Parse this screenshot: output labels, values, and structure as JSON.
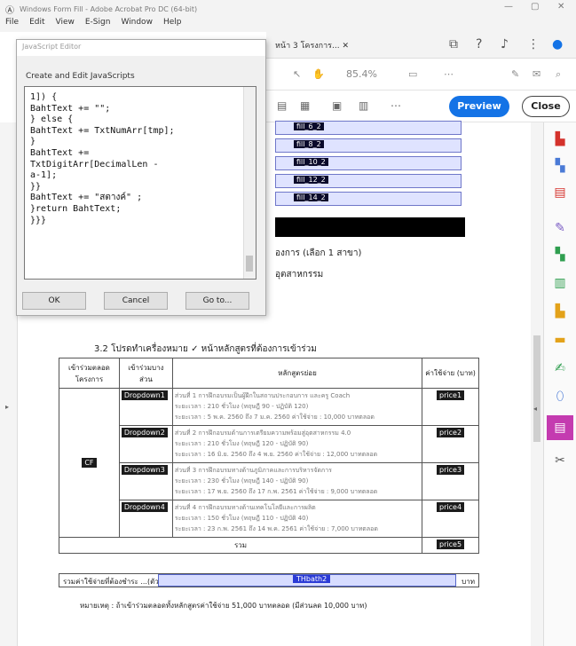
{
  "window": {
    "title": "Windows Form Fill - Adobe Acrobat Pro DC (64-bit)",
    "controls": [
      "—",
      "▢",
      "✕"
    ]
  },
  "menu": [
    "File",
    "Edit",
    "View",
    "E-Sign",
    "Window",
    "Help"
  ],
  "tab": {
    "label": "หน้า 3 โครงการ..."
  },
  "toolbar": {
    "zoom": "85.4%"
  },
  "edit_bar": {
    "preview": "Preview",
    "close": "Close"
  },
  "fields": [
    "fill_6_2",
    "fill_8_2",
    "fill_10_2",
    "fill_12_2",
    "fill_14_2"
  ],
  "doc_text": {
    "line1": "องการ (เลือก 1 สาขา)",
    "line2": "อุตสาหกรรม",
    "heading": "3.2 โปรดทำเครื่องหมาย ✓ หน้าหลักสูตรที่ต้องการเข้าร่วม",
    "footnote": "หมายเหตุ : ถ้าเข้าร่วมตลอดทั้งหลักสูตรค่าใช้จ่าย 51,000 บาทตลอด (มีส่วนลด 10,000 บาท)"
  },
  "dialog": {
    "title": "JavaScript Editor",
    "subtitle": "Create and Edit JavaScripts",
    "code": "1]) {\nBahtText += \"\";\n} else {\nBahtText += TxtNumArr[tmp];\n}\nBahtText +=\nTxtDigitArr[DecimalLen -\na-1];\n}}\nBahtText += \"สตางค์\" ;\n}return BahtText;\n}}}",
    "ok": "OK",
    "cancel": "Cancel",
    "goto": "Go to..."
  },
  "table": {
    "headers": [
      "เข้าร่วมตลอดโครงการ",
      "เข้าร่วมบางส่วน",
      "หลักสูตรย่อย",
      "ค่าใช้จ่าย (บาท)"
    ],
    "full_checkbox": "CF",
    "rows": [
      {
        "dropdown": "Dropdown1",
        "title": "ส่วนที่ 1 การฝึกอบรมเป็นผู้ฝึกในสถานประกอบการ และครู Coach",
        "detail1": "ระยะเวลา : 210 ชั่วโมง (ทฤษฎี 90 - ปฏิบัติ 120)",
        "detail2": "ระยะเวลา : 5 พ.ค. 2560 ถึง 7 ม.ค. 2560 ค่าใช้จ่าย : 10,000 บาทตลอด",
        "price": "price1"
      },
      {
        "dropdown": "Dropdown2",
        "title": "ส่วนที่ 2 การฝึกอบรมด้านการเตรียมความพร้อมสู่อุตสาหกรรม 4.0",
        "detail1": "ระยะเวลา : 210 ชั่วโมง (ทฤษฎี 120 - ปฏิบัติ 90)",
        "detail2": "ระยะเวลา : 16 มิ.ย. 2560 ถึง 4 พ.ย. 2560 ค่าใช้จ่าย : 12,000 บาทตลอด",
        "price": "price2"
      },
      {
        "dropdown": "Dropdown3",
        "title": "ส่วนที่ 3 การฝึกอบรมทางด้านภูมิภาคและการบริหารจัดการ",
        "detail1": "ระยะเวลา : 230 ชั่วโมง (ทฤษฎี 140 - ปฏิบัติ 90)",
        "detail2": "ระยะเวลา : 17 พ.ย. 2560 ถึง 17 ก.พ. 2561 ค่าใช้จ่าย : 9,000 บาทตลอด",
        "price": "price3"
      },
      {
        "dropdown": "Dropdown4",
        "title": "ส่วนที่ 4 การฝึกอบรมทางด้านเทคโนโลยีและการผลิต",
        "detail1": "ระยะเวลา : 150 ชั่วโมง (ทฤษฎี 110 - ปฏิบัติ 40)",
        "detail2": "ระยะเวลา : 23 ก.พ. 2561 ถึง 14 พ.ค. 2561 ค่าใช้จ่าย : 7,000 บาทตลอด",
        "price": "price4"
      }
    ],
    "total_label": "รวม",
    "total_price": "price5",
    "sum_label": "รวมค่าใช้จ่ายที่ต้องชำระ ...(ตัวหนังสือ)...",
    "thbath": "THbath2",
    "baht": "บาท"
  }
}
